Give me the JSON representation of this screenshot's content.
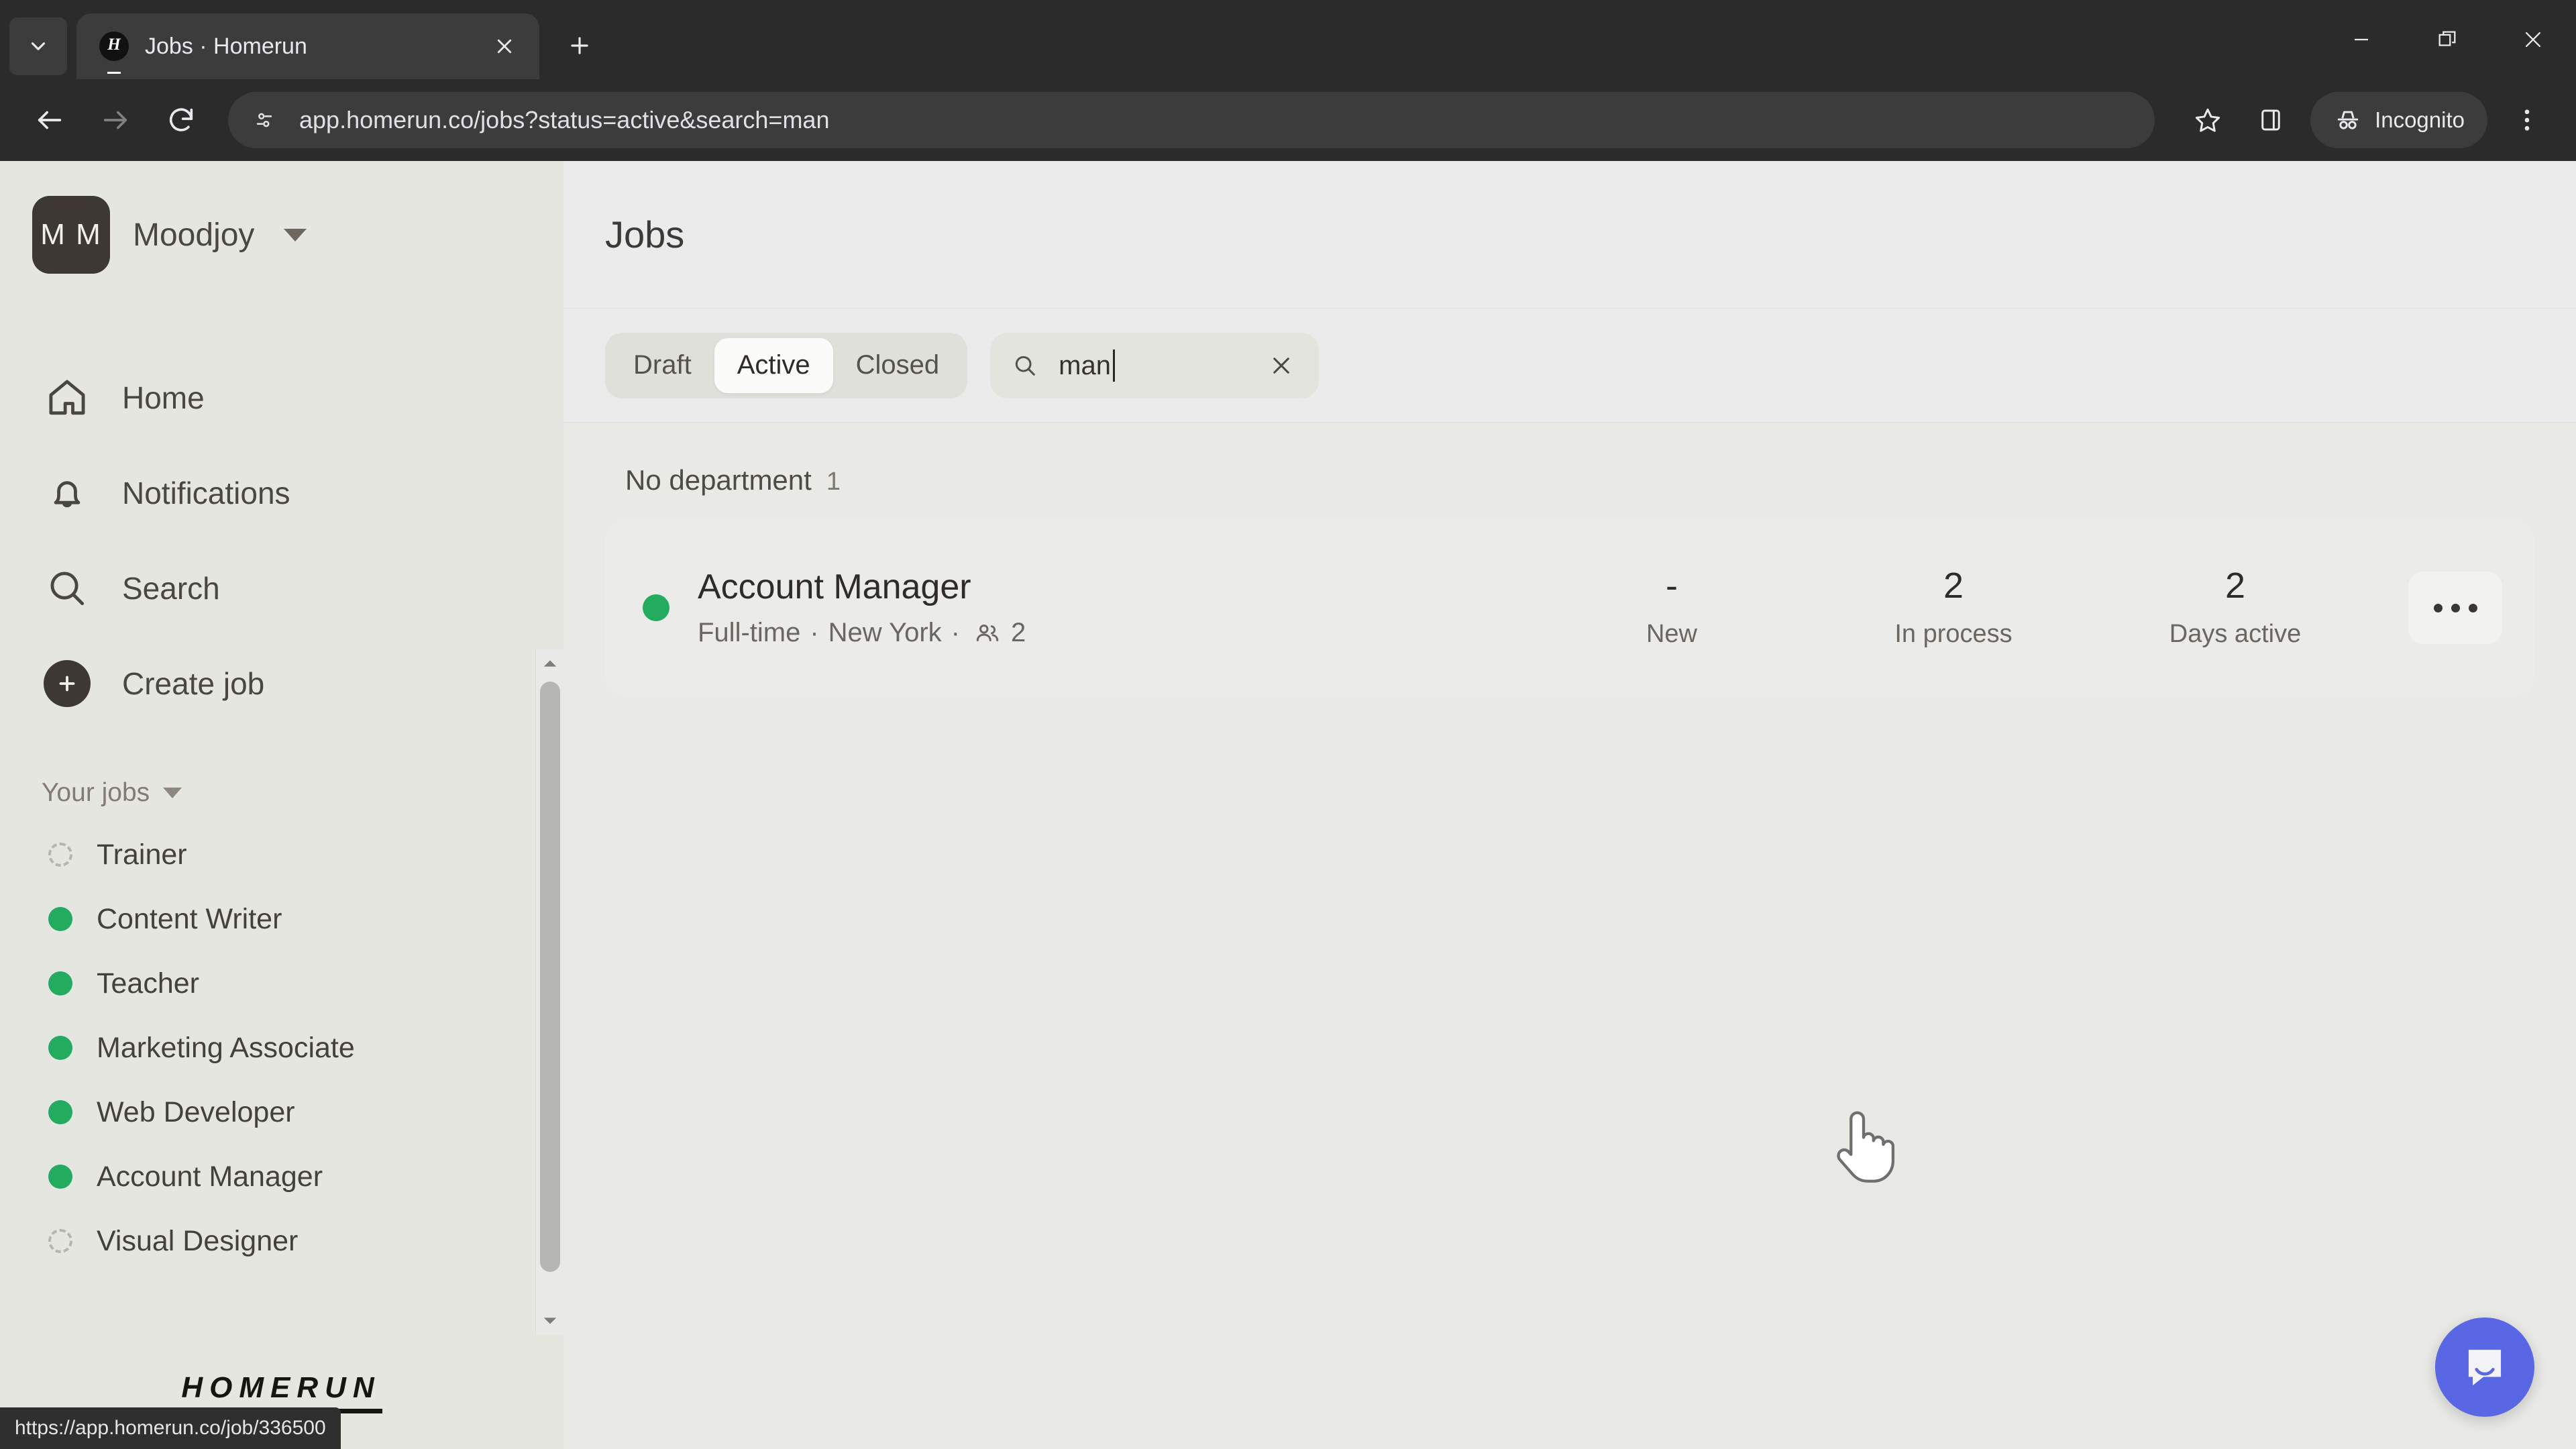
{
  "browser": {
    "tab": {
      "title": "Jobs · Homerun",
      "favicon_letter": "H",
      "favicon_icon": "homerun-logo-icon",
      "close_icon": "close-icon"
    },
    "tab_search_icon": "chevron-down-icon",
    "new_tab_icon": "plus-icon",
    "window": {
      "minimize_icon": "minimize-icon",
      "maximize_icon": "restore-window-icon",
      "close_icon": "close-window-icon"
    },
    "toolbar": {
      "back_icon": "back-arrow-icon",
      "forward_icon": "forward-arrow-icon",
      "reload_icon": "reload-icon",
      "site_info_icon": "site-settings-icon",
      "url": "app.homerun.co/jobs?status=active&search=man",
      "bookmark_icon": "star-icon",
      "side_panel_icon": "side-panel-icon",
      "incognito_label": "Incognito",
      "incognito_icon": "incognito-hat-icon",
      "menu_icon": "three-dot-menu-icon"
    }
  },
  "sidebar": {
    "org": {
      "initials": "M M",
      "name": "Moodjoy",
      "caret_icon": "chevron-down-icon"
    },
    "nav": [
      {
        "label": "Home",
        "icon": "home-icon"
      },
      {
        "label": "Notifications",
        "icon": "bell-icon"
      },
      {
        "label": "Search",
        "icon": "search-icon"
      },
      {
        "label": "Create job",
        "icon": "plus-circle-icon"
      }
    ],
    "section": {
      "label": "Your jobs",
      "caret_icon": "chevron-down-icon"
    },
    "jobs": [
      {
        "label": "Trainer",
        "status": "draft"
      },
      {
        "label": "Content Writer",
        "status": "active"
      },
      {
        "label": "Teacher",
        "status": "active"
      },
      {
        "label": "Marketing Associate",
        "status": "active"
      },
      {
        "label": "Web Developer",
        "status": "active"
      },
      {
        "label": "Account Manager",
        "status": "active"
      },
      {
        "label": "Visual Designer",
        "status": "draft"
      }
    ],
    "brand": "HOMERUN",
    "scrollbar": {
      "up_icon": "scroll-up-arrow-icon",
      "down_icon": "scroll-down-arrow-icon"
    }
  },
  "main": {
    "title": "Jobs",
    "filters": {
      "segments": [
        {
          "label": "Draft",
          "active": false
        },
        {
          "label": "Active",
          "active": true
        },
        {
          "label": "Closed",
          "active": false
        }
      ],
      "search": {
        "value": "man",
        "placeholder": "Search",
        "icon": "search-icon",
        "clear_icon": "close-icon"
      }
    },
    "department": {
      "name": "No department",
      "count": "1"
    },
    "job_row": {
      "status": "active",
      "title": "Account Manager",
      "meta_employment": "Full-time",
      "meta_location": "New York",
      "meta_people_icon": "people-icon",
      "meta_people_count": "2",
      "stats": [
        {
          "value": "-",
          "label": "New"
        },
        {
          "value": "2",
          "label": "In process"
        },
        {
          "value": "2",
          "label": "Days active"
        }
      ],
      "menu_icon": "three-dot-menu-icon"
    },
    "chat_icon": "intercom-chat-icon"
  },
  "status_bar": {
    "url": "https://app.homerun.co/job/336500"
  },
  "colors": {
    "accent_green": "#23ab5f",
    "chat_blue": "#5a67e5",
    "sidebar_bg": "#e6e6e1",
    "content_bg": "#e9e9e6",
    "header_bg": "#ebebeb"
  }
}
